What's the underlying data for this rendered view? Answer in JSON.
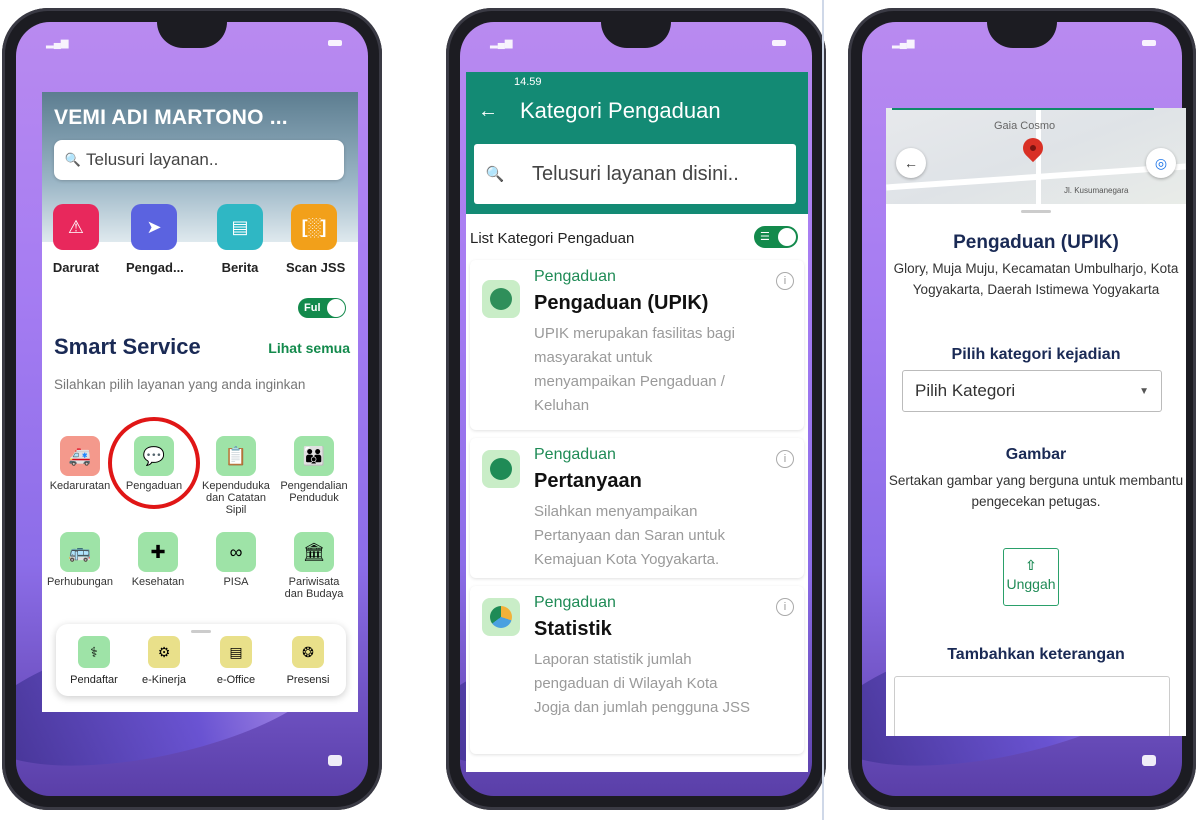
{
  "screen1": {
    "user_name": "VEMI ADI MARTONO ...",
    "search_placeholder": "Telusuri layanan..",
    "quick_actions": [
      {
        "label": "Darurat",
        "icon": "siren-icon",
        "color": "#e8285c"
      },
      {
        "label": "Pengad...",
        "icon": "send-icon",
        "color": "#5b63e0"
      },
      {
        "label": "Berita",
        "icon": "news-icon",
        "color": "#2fb7c4"
      },
      {
        "label": "Scan JSS",
        "icon": "scan-icon",
        "color": "#f2a01a"
      }
    ],
    "toggle_label": "Ful",
    "section_title": "Smart Service",
    "see_all": "Lihat semua",
    "section_desc": "Silahkan pilih layanan yang anda inginkan",
    "services": [
      {
        "label": "Kedaruratan",
        "icon": "ambulance-icon",
        "color": "#f4998c"
      },
      {
        "label": "Pengaduan",
        "icon": "complaint-icon",
        "color": "#9ee3a7"
      },
      {
        "label": "Kependudukan dan Catatan Sipil",
        "icon": "id-card-icon",
        "color": "#9ee3a7"
      },
      {
        "label": "Pengendalian Penduduk",
        "icon": "family-icon",
        "color": "#9ee3a7"
      },
      {
        "label": "Perhubungan",
        "icon": "bus-icon",
        "color": "#9ee3a7"
      },
      {
        "label": "Kesehatan",
        "icon": "medkit-icon",
        "color": "#9ee3a7"
      },
      {
        "label": "PISA",
        "icon": "binoculars-icon",
        "color": "#9ee3a7"
      },
      {
        "label": "Pariwisata dan Budaya",
        "icon": "tourism-icon",
        "color": "#9ee3a7"
      }
    ],
    "dock": [
      {
        "label": "Pendaftar",
        "icon": "stethoscope-icon",
        "color": "#9ee3a7"
      },
      {
        "label": "e-Kinerja",
        "icon": "person-chart-icon",
        "color": "#e9e08a"
      },
      {
        "label": "e-Office",
        "icon": "document-icon",
        "color": "#e9e08a"
      },
      {
        "label": "Presensi",
        "icon": "fingerprint-icon",
        "color": "#e9e08a"
      }
    ]
  },
  "screen2": {
    "status_bar": "14.59",
    "title": "Kategori Pengaduan",
    "search_placeholder": "Telusuri layanan disini..",
    "list_label": "List Kategori Pengaduan",
    "items": [
      {
        "category": "Pengaduan",
        "name": "Pengaduan (UPIK)",
        "desc": "UPIK merupakan fasilitas bagi masyarakat untuk menyampaikan Pengaduan / Keluhan",
        "icon": "megaphone-icon"
      },
      {
        "category": "Pengaduan",
        "name": "Pertanyaan",
        "desc": "Silahkan menyampaikan Pertanyaan dan Saran untuk Kemajuan Kota Yogyakarta.",
        "icon": "question-hand-icon"
      },
      {
        "category": "Pengaduan",
        "name": "Statistik",
        "desc": "Laporan statistik jumlah pengaduan di Wilayah Kota Jogja dan jumlah pengguna JSS",
        "icon": "pie-chart-icon"
      }
    ]
  },
  "screen3": {
    "map_place": "Gaia Cosmo",
    "map_street": "Jl. Kusumanegara",
    "title": "Pengaduan (UPIK)",
    "address": "Glory, Muja Muju, Kecamatan Umbulharjo, Kota Yogyakarta,  Daerah Istimewa Yogyakarta",
    "category_heading": "Pilih kategori kejadian",
    "category_select": "Pilih Kategori",
    "image_heading": "Gambar",
    "image_desc": "Sertakan gambar yang berguna untuk membantu pengecekan petugas.",
    "upload_label": "Unggah",
    "note_heading": "Tambahkan keterangan"
  }
}
